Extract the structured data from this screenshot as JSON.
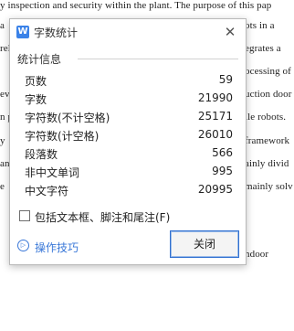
{
  "document": {
    "line1": "y inspection and security within the plant. The purpose of this pap",
    "line2_tail": "ots in a",
    "line3_tail": "egrates a",
    "line4_tail": "ocessing of",
    "line5_tail": "uction door",
    "line6_tail": "ile robots.",
    "line7_tail": "framework",
    "line8_tail": "ainly divid",
    "line9_tail": "mainly solv",
    "line10_tail": "ndoor",
    "left_margin_chars": [
      "a",
      "rel",
      "ev",
      "n p",
      "y",
      "an(",
      "e"
    ]
  },
  "dialog": {
    "title": "字数统计",
    "app_icon": "W",
    "close_icon": "✕",
    "group_title": "统计信息",
    "stats": [
      {
        "label": "页数",
        "value": "59"
      },
      {
        "label": "字数",
        "value": "21990"
      },
      {
        "label": "字符数(不计空格)",
        "value": "25171"
      },
      {
        "label": "字符数(计空格)",
        "value": "26010"
      },
      {
        "label": "段落数",
        "value": "566"
      },
      {
        "label": "非中文单词",
        "value": "995"
      },
      {
        "label": "中文字符",
        "value": "20995"
      }
    ],
    "checkbox_label": "包括文本框、脚注和尾注(F)",
    "checkbox_checked": false,
    "tips_label": "操作技巧",
    "tips_icon": "▷",
    "close_button_label": "关闭"
  },
  "colors": {
    "accent": "#2f6fd0",
    "link": "#3a78d8",
    "app_icon": "#3a82e8"
  }
}
